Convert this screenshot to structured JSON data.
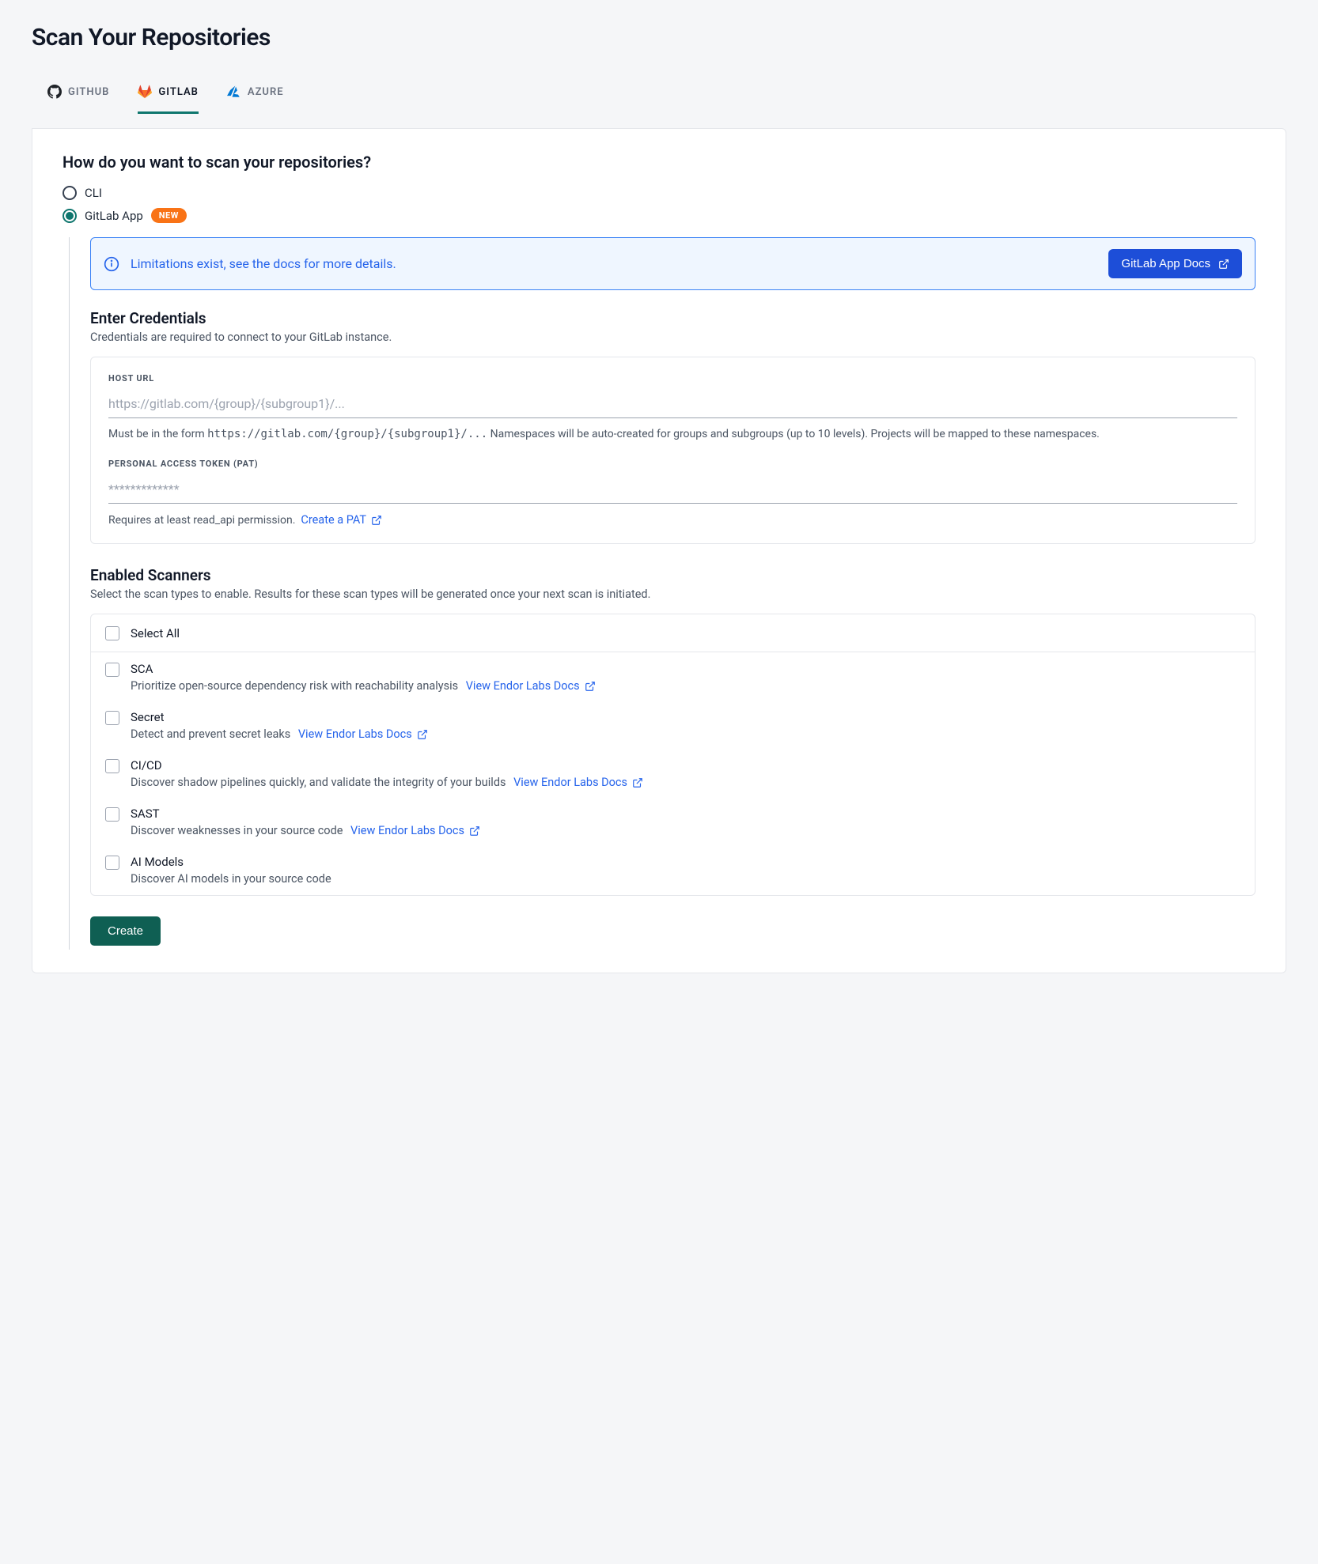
{
  "page": {
    "title": "Scan Your Repositories"
  },
  "tabs": {
    "github": "GITHUB",
    "gitlab": "GITLAB",
    "azure": "AZURE",
    "active": "gitlab"
  },
  "scan_method": {
    "question": "How do you want to scan your repositories?",
    "cli_label": "CLI",
    "gitlab_app_label": "GitLab App",
    "new_badge": "NEW",
    "selected": "gitlab_app"
  },
  "alert": {
    "text": "Limitations exist, see the docs for more details.",
    "button": "GitLab App Docs"
  },
  "credentials": {
    "title": "Enter Credentials",
    "desc": "Credentials are required to connect to your GitLab instance.",
    "host_label": "HOST URL",
    "host_placeholder": "https://gitlab.com/{group}/{subgroup1}/...",
    "host_help_prefix": "Must be in the form ",
    "host_help_code": "https://gitlab.com/{group}/{subgroup1}/...",
    "host_help_suffix": " Namespaces will be auto-created for groups and subgroups (up to 10 levels). Projects will be mapped to these namespaces.",
    "pat_label": "PERSONAL ACCESS TOKEN (PAT)",
    "pat_placeholder": "*************",
    "pat_help": "Requires at least read_api permission.",
    "pat_link": "Create a PAT"
  },
  "scanners": {
    "title": "Enabled Scanners",
    "desc": "Select the scan types to enable. Results for these scan types will be generated once your next scan is initiated.",
    "select_all": "Select All",
    "docs_link": "View Endor Labs Docs",
    "items": [
      {
        "name": "SCA",
        "desc": "Prioritize open-source dependency risk with reachability analysis",
        "has_link": true
      },
      {
        "name": "Secret",
        "desc": "Detect and prevent secret leaks",
        "has_link": true
      },
      {
        "name": "CI/CD",
        "desc": "Discover shadow pipelines quickly, and validate the integrity of your builds",
        "has_link": true
      },
      {
        "name": "SAST",
        "desc": "Discover weaknesses in your source code",
        "has_link": true
      },
      {
        "name": "AI Models",
        "desc": "Discover AI models in your source code",
        "has_link": false
      }
    ]
  },
  "actions": {
    "create": "Create"
  }
}
